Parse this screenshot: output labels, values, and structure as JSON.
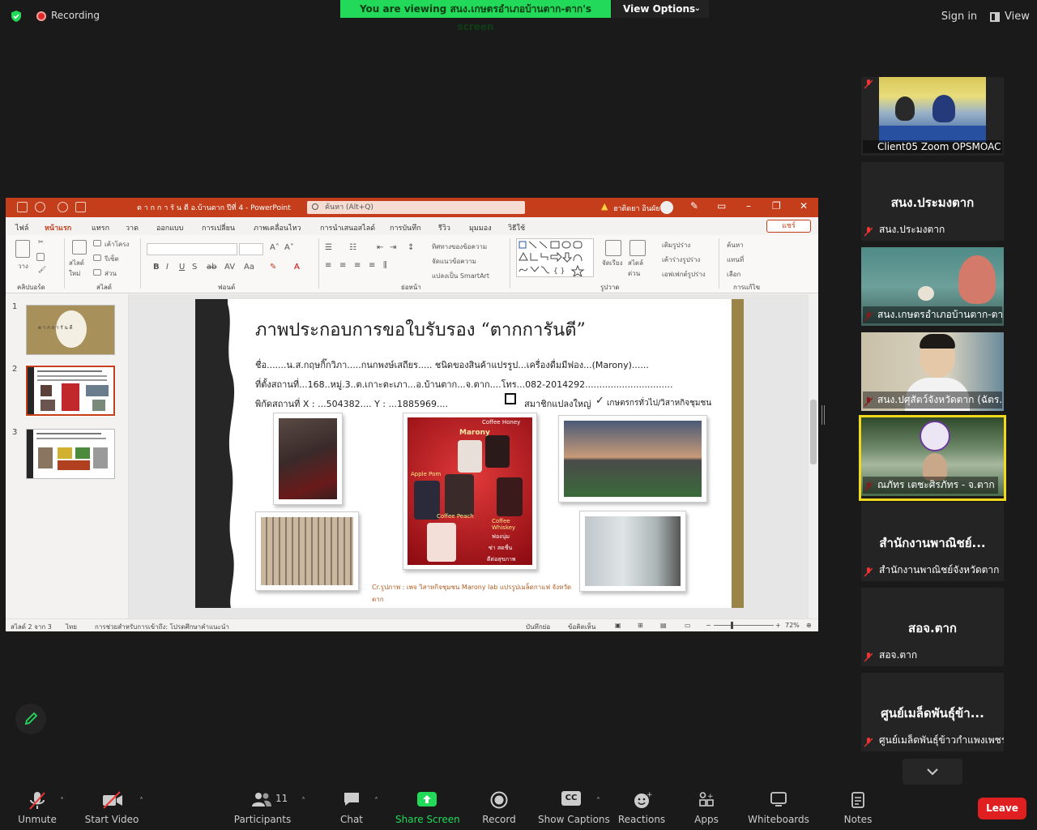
{
  "top": {
    "recording": "Recording",
    "viewing_banner": "You are viewing สนง.เกษตรอำเภอบ้านตาก-ตาก's screen",
    "view_options": "View Options",
    "sign_in": "Sign in",
    "view": "View"
  },
  "ppt": {
    "doc_title": "ต า ก ก า รั น ตี อ.บ้านตาก ปีที่ 4  -  PowerPoint",
    "search_placeholder": "ค้นหา (Alt+Q)",
    "user": "ฮาติดยา อินผัย",
    "share": "แชร์",
    "tabs": [
      "ไฟล์",
      "หน้าแรก",
      "แทรก",
      "วาด",
      "ออกแบบ",
      "การเปลี่ยน",
      "ภาพเคลื่อนไหว",
      "การนำเสนอสไลด์",
      "การบันทึก",
      "รีวิว",
      "มุมมอง",
      "วิธีใช้"
    ],
    "ribbon": {
      "groups": [
        "คลิปบอร์ด",
        "สไลด์",
        "ฟอนต์",
        "ย่อหน้า",
        "รูปวาด",
        "การแก้ไข"
      ],
      "paste": "วาง",
      "new_slide": "สไลด์ใหม่",
      "layout": "เค้าโครง",
      "reset": "รีเซ็ต",
      "section": "ส่วน",
      "text_direction": "ทิศทางของข้อความ",
      "align_text": "จัดแนวข้อความ",
      "smartart": "แปลงเป็น SmartArt",
      "arrange": "จัดเรียง",
      "quick_styles": "สไตล์ด่วน",
      "shape_fill": "เติมรูปร่าง",
      "shape_outline": "เค้าร่างรูปร่าง",
      "shape_effects": "เอฟเฟกต์รูปร่าง",
      "find": "ค้นหา",
      "replace": "แทนที่",
      "select": "เลือก"
    },
    "thumbs": [
      "1",
      "2",
      "3"
    ],
    "thumb1_text": "ต า ก ก า รั น ตี",
    "slide": {
      "title": "ภาพประกอบการขอใบรับรอง  “ตากการันตี”",
      "line1": "ชื่อ.......น.ส.กฤษกิ๊กวิภา.....กนกพงษ์เสถียร.....    ชนิดของสินค้าแปรรูป...เครื่องดื่มมีฟอง...(Marony)......",
      "line2": "ที่ตั้งสถานที่...168..หมู่.3..ต.เกาะตะเภา...อ.บ้านตาก...จ.ตาก....โทร...082-2014292...............................",
      "line3": "พิกัดสถานที่   X  :  ...504382....   Y  :  ...1885969....",
      "member": "สมาชิกแปลงใหญ่",
      "farmer": "เกษตรกรทั่วไป/วิสาหกิจชุมชน",
      "poster_brand": "Marony",
      "poster_top": "Coffee Honey",
      "poster_left": "Apple Pom",
      "poster_mid": "Coffee Peach",
      "poster_right": "Coffee Whiskey",
      "poster_notes": [
        "ฟองนุ่ม",
        "ซ่า สดชื่น",
        "ดีต่อสุขภาพ"
      ],
      "caption": "Cr.รูปภาพ : เพจ วิสาหกิจชุมชน Marony lab แปรรูปเมล็ดกาแฟ จังหวัดตาก"
    },
    "status": {
      "slide_of": "สไลด์ 2 จาก 3",
      "lang": "ไทย",
      "accessibility": "การช่วยสำหรับการเข้าถึง: โปรดศึกษาคำแนะนำ",
      "notes": "บันทึกย่อ",
      "comments": "ข้อคิดเห็น",
      "zoom": "72%"
    }
  },
  "gallery": [
    {
      "name": "Client05 Zoom OPSMOAC",
      "big": "",
      "video": true
    },
    {
      "name": "สนง.ประมงตาก",
      "big": "สนง.ประมงตาก",
      "video": false
    },
    {
      "name": "สนง.เกษตรอำเภอบ้านตาก-ตาก",
      "big": "",
      "video": true
    },
    {
      "name": "สนง.ปศุสัตว์จังหวัดตาก (ฉัตร...",
      "big": "",
      "video": true
    },
    {
      "name": "ณภัทร เตชะศิรภัทร - จ.ตาก",
      "big": "",
      "video": true
    },
    {
      "name": "สำนักงานพาณิชย์จังหวัดตาก",
      "big": "สำนักงานพาณิชย์...",
      "video": false
    },
    {
      "name": "สอจ.ตาก",
      "big": "สอจ.ตาก",
      "video": false
    },
    {
      "name": "ศูนย์เมล็ดพันธุ์ข้าวกำแพงเพชร",
      "big": "ศูนย์เมล็ดพันธุ์ข้า...",
      "video": false
    }
  ],
  "toolbar": {
    "unmute": "Unmute",
    "start_video": "Start Video",
    "participants": "Participants",
    "participants_count": "11",
    "chat": "Chat",
    "share_screen": "Share Screen",
    "record": "Record",
    "captions": "Show Captions",
    "cc": "CC",
    "reactions": "Reactions",
    "apps": "Apps",
    "whiteboards": "Whiteboards",
    "notes": "Notes",
    "leave": "Leave"
  },
  "colors": {
    "banner": "#23d959",
    "ppt_accent": "#c43e1c",
    "share_green": "#23d959",
    "leave": "#e02020",
    "active_speaker": "#f1d91d"
  }
}
